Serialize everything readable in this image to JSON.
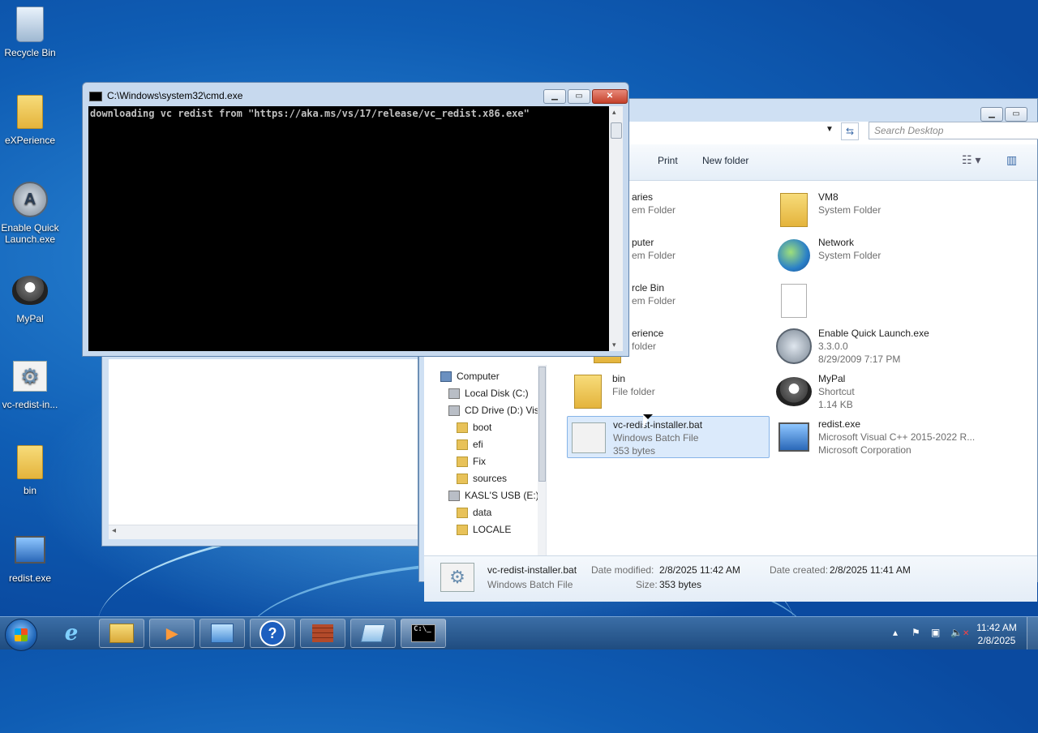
{
  "desktop": {
    "icons": [
      {
        "label": "Recycle Bin",
        "icon": "recycle-bin-icon"
      },
      {
        "label": "eXPerience",
        "icon": "folder-icon"
      },
      {
        "label": "Enable Quick Launch.exe",
        "icon": "quick-launch-app-icon"
      },
      {
        "label": "MyPal",
        "icon": "mypal-browser-icon"
      },
      {
        "label": "vc-redist-in...",
        "icon": "batch-file-icon"
      },
      {
        "label": "bin",
        "icon": "folder-icon"
      },
      {
        "label": "redist.exe",
        "icon": "installer-icon"
      }
    ]
  },
  "cmd": {
    "title": "C:\\Windows\\system32\\cmd.exe",
    "output": "downloading vc redist from \"https://aka.ms/vs/17/release/vc_redist.x86.exe\""
  },
  "explorer": {
    "search_placeholder": "Search Desktop",
    "toolbar": {
      "print": "Print",
      "new_folder": "New folder"
    },
    "nav": [
      {
        "label": "Computer",
        "kind": "pc",
        "indent": 0
      },
      {
        "label": "Local Disk (C:)",
        "kind": "disk",
        "indent": 1
      },
      {
        "label": "CD Drive (D:) Vist",
        "kind": "disk",
        "indent": 1
      },
      {
        "label": "boot",
        "kind": "folder",
        "indent": 2
      },
      {
        "label": "efi",
        "kind": "folder",
        "indent": 2
      },
      {
        "label": "Fix",
        "kind": "folder",
        "indent": 2
      },
      {
        "label": "sources",
        "kind": "folder",
        "indent": 2
      },
      {
        "label": "KASL'S USB (E:)",
        "kind": "disk",
        "indent": 1
      },
      {
        "label": "data",
        "kind": "folder",
        "indent": 2
      },
      {
        "label": "LOCALE",
        "kind": "folder",
        "indent": 2
      }
    ],
    "left_files": [
      {
        "name": "aries",
        "type": "em Folder",
        "extra": ""
      },
      {
        "name": "puter",
        "type": "em Folder",
        "extra": ""
      },
      {
        "name": "rcle Bin",
        "type": "em Folder",
        "extra": ""
      },
      {
        "name": "erience",
        "type": "folder",
        "extra": ""
      },
      {
        "name": "bin",
        "type": "File folder",
        "extra": ""
      },
      {
        "name": "vc-redist-installer.bat",
        "type": "Windows Batch File",
        "extra": "353 bytes"
      }
    ],
    "right_files": [
      {
        "name": "VM8",
        "type": "System Folder",
        "extra": ""
      },
      {
        "name": "Network",
        "type": "System Folder",
        "extra": ""
      },
      {
        "name": "",
        "type": "",
        "extra": ""
      },
      {
        "name": "Enable Quick Launch.exe",
        "type": "3.3.0.0",
        "extra": "8/29/2009 7:17 PM"
      },
      {
        "name": "MyPal",
        "type": "Shortcut",
        "extra": "1.14 KB"
      },
      {
        "name": "redist.exe",
        "type": "Microsoft Visual C++ 2015-2022 R...",
        "extra": "Microsoft Corporation"
      }
    ],
    "details": {
      "name": "vc-redist-installer.bat",
      "type": "Windows Batch File",
      "modified_label": "Date modified:",
      "modified": "2/8/2025 11:42 AM",
      "size_label": "Size:",
      "size": "353 bytes",
      "created_label": "Date created:",
      "created": "2/8/2025 11:41 AM"
    }
  },
  "taskbar": {
    "time": "11:42 AM",
    "date": "2/8/2025",
    "buttons": [
      "internet-explorer-icon",
      "file-explorer-icon",
      "media-player-icon",
      "control-panel-icon",
      "help-icon",
      "firewall-icon",
      "notepad-icon",
      "cmd-icon"
    ]
  }
}
